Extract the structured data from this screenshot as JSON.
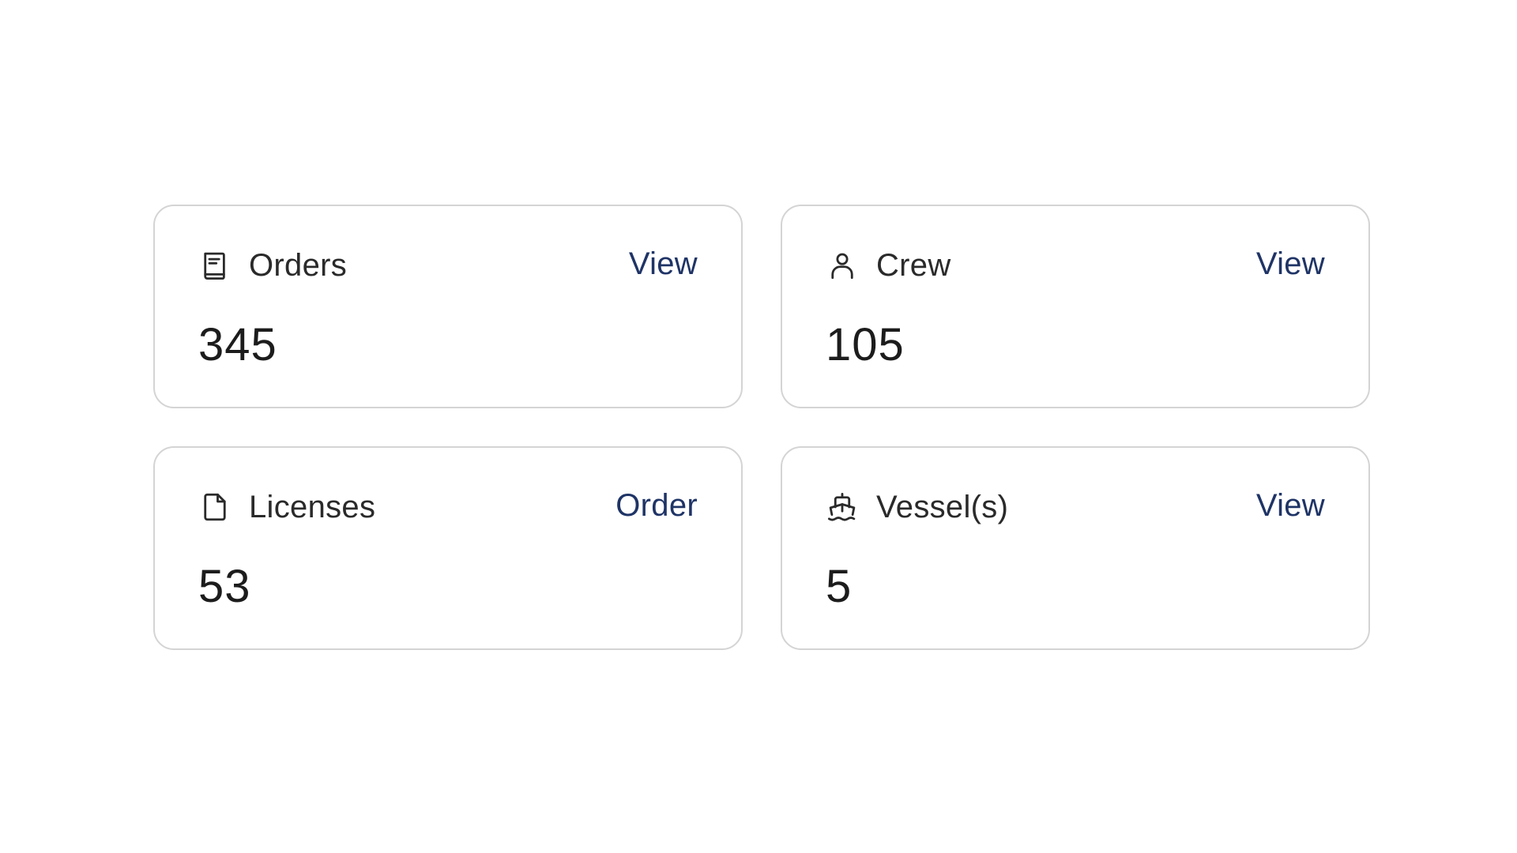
{
  "cards": [
    {
      "title": "Orders",
      "action": "View",
      "value": "345",
      "icon": "book-icon"
    },
    {
      "title": "Crew",
      "action": "View",
      "value": "105",
      "icon": "user-icon"
    },
    {
      "title": "Licenses",
      "action": "Order",
      "value": "53",
      "icon": "file-icon"
    },
    {
      "title": "Vessel(s)",
      "action": "View",
      "value": "5",
      "icon": "ship-icon"
    }
  ],
  "colors": {
    "action_link": "#1f3466",
    "card_border": "#d4d4d4",
    "text_primary": "#2a2a2a"
  }
}
